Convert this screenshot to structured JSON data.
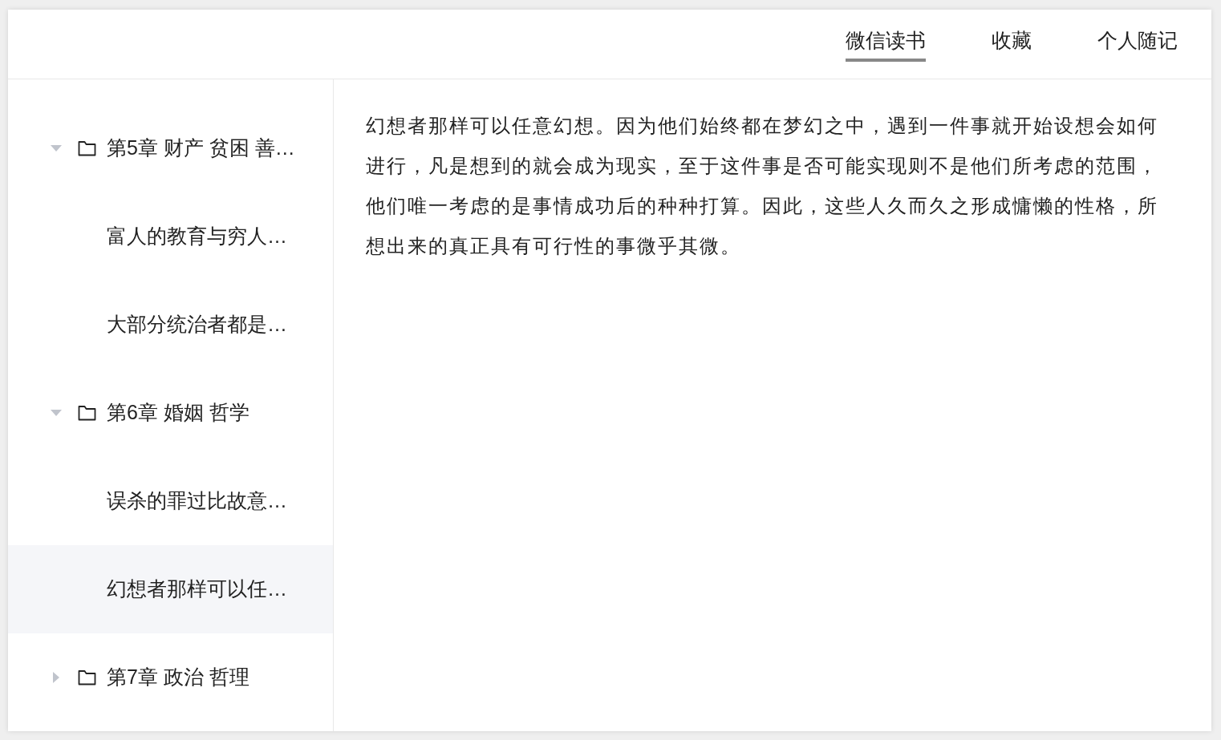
{
  "nav": {
    "tabs": [
      {
        "label": "微信读书",
        "selected": true
      },
      {
        "label": "收藏",
        "selected": false
      },
      {
        "label": "个人随记",
        "selected": false
      }
    ]
  },
  "tree": [
    {
      "label": "第5章 财产 贫困 善…",
      "expanded": true,
      "children": [
        {
          "label": "富人的教育与穷人…",
          "selected": false
        },
        {
          "label": "大部分统治者都是…",
          "selected": false
        }
      ]
    },
    {
      "label": "第6章 婚姻 哲学",
      "expanded": true,
      "children": [
        {
          "label": "误杀的罪过比故意…",
          "selected": false
        },
        {
          "label": "幻想者那样可以任…",
          "selected": true
        }
      ]
    },
    {
      "label": "第7章 政治 哲理",
      "expanded": false
    }
  ],
  "content": {
    "paragraph": "幻想者那样可以任意幻想。因为他们始终都在梦幻之中，遇到一件事就开始设想会如何进行，凡是想到的就会成为现实，至于这件事是否可能实现则不是他们所考虑的范围，他们唯一考虑的是事情成功后的种种打算。因此，这些人久而久之形成慵懒的性格，所想出来的真正具有可行性的事微乎其微。"
  }
}
